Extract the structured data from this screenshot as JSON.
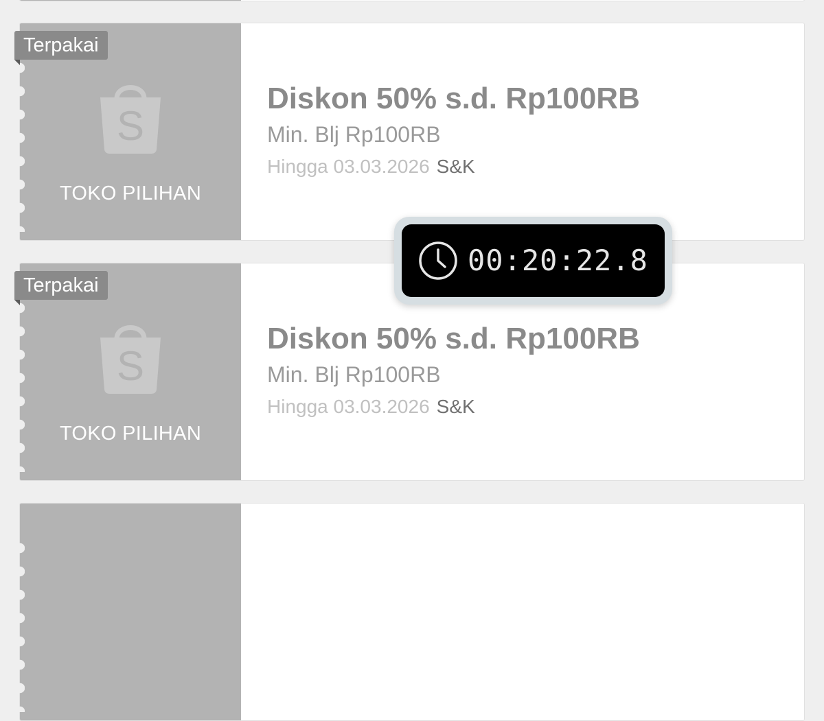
{
  "vouchers": [
    {
      "badge": "Terpakai",
      "shop_label": "TOKO PILIHAN",
      "bag_letter": "S",
      "title": "Diskon 50% s.d. Rp100RB",
      "min_spend": "Min. Blj Rp100RB",
      "expiry": "Hingga 03.03.2026",
      "terms": "S&K"
    },
    {
      "badge": "Terpakai",
      "shop_label": "TOKO PILIHAN",
      "bag_letter": "S",
      "title": "Diskon 50% s.d. Rp100RB",
      "min_spend": "Min. Blj Rp100RB",
      "expiry": "Hingga 03.03.2026",
      "terms": "S&K"
    }
  ],
  "timer": {
    "icon": "clock-icon",
    "value": "00:20:22.8"
  },
  "colors": {
    "stub": "#b3b3b3",
    "badge": "#8a8a8a",
    "timer_bg": "#000000",
    "timer_frame": "#d6dee2"
  }
}
